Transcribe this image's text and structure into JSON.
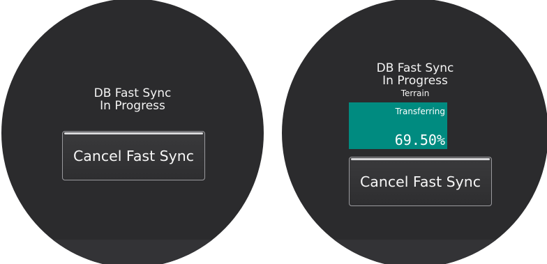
{
  "left_panel": {
    "status_line1": "DB Fast Sync",
    "status_line2": "In Progress",
    "cancel_label": "Cancel Fast Sync"
  },
  "right_panel": {
    "status_line1": "DB Fast Sync",
    "status_line2": "In Progress",
    "database": "Terrain",
    "progress_label": "Transferring",
    "progress_value": "69.50%",
    "progress_percent": 69.5,
    "cancel_label": "Cancel Fast Sync"
  },
  "colors": {
    "screen_background": "#2b2b2d",
    "progress_fill": "#008b80",
    "text": "#f4f4f4"
  }
}
